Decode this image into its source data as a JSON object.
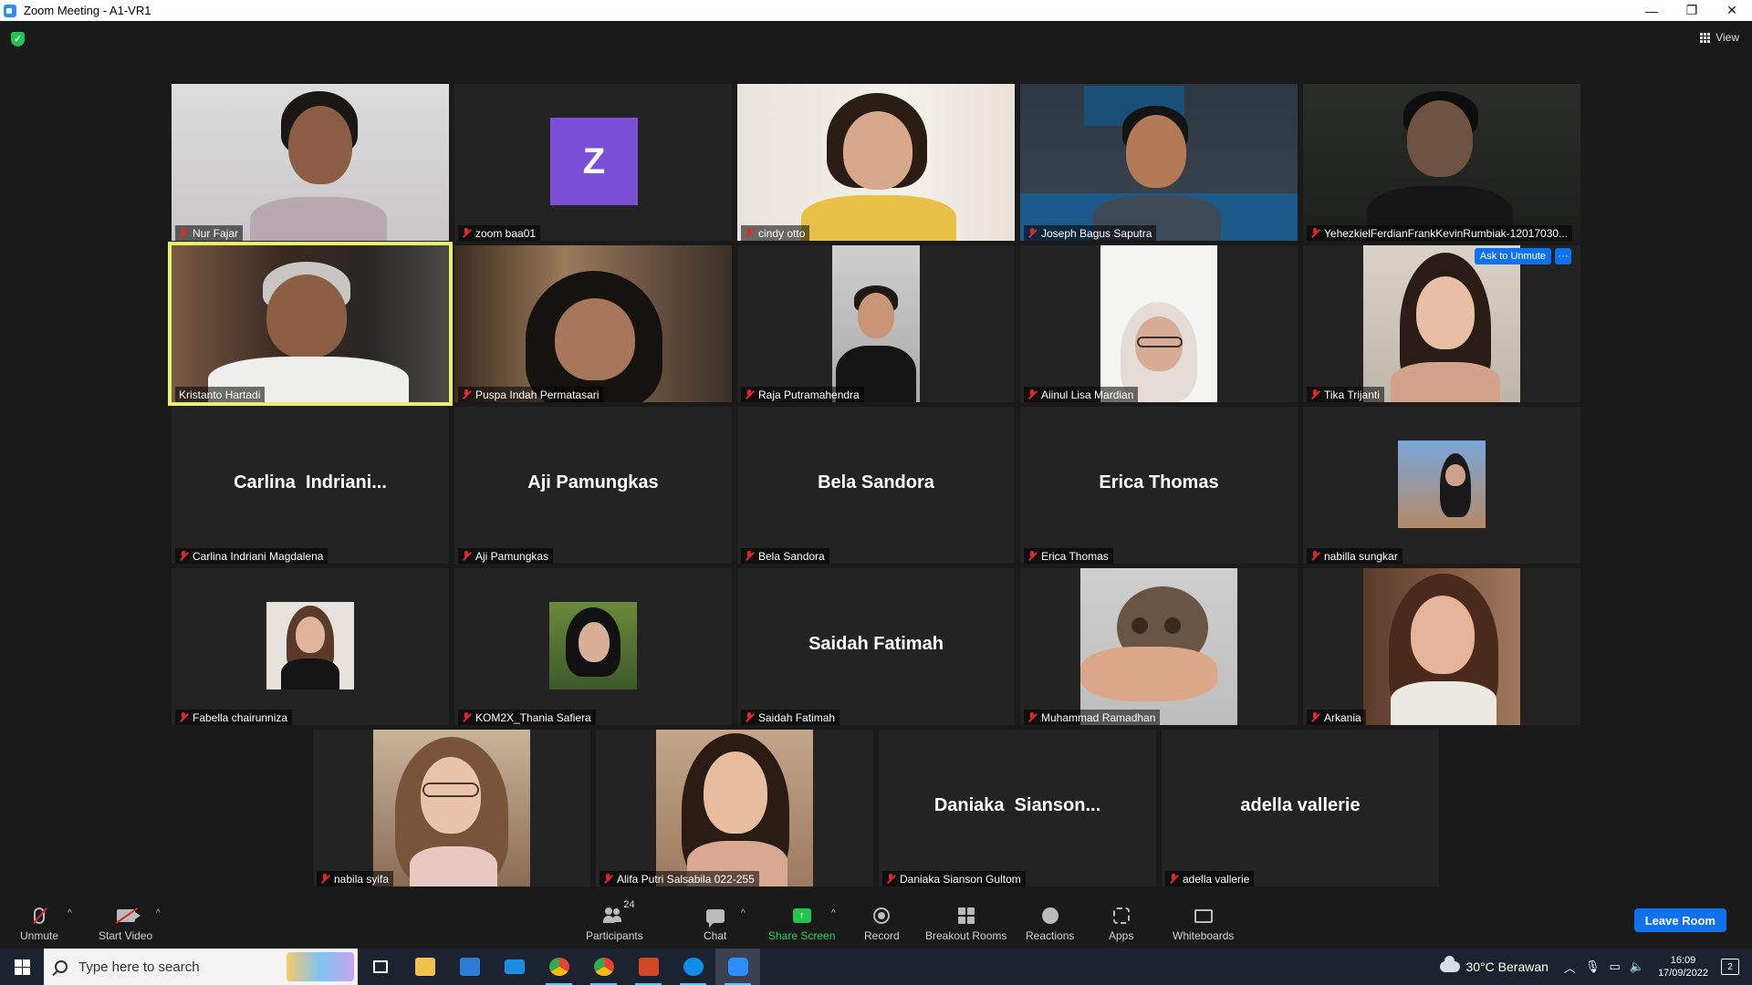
{
  "window": {
    "title": "Zoom Meeting - A1-VR1",
    "minimize": "—",
    "restore": "❐",
    "close": "✕"
  },
  "topbar": {
    "view_label": "View"
  },
  "participants": [
    {
      "name": "Nur Fajar"
    },
    {
      "name": "zoom baa01",
      "avatar_letter": "Z"
    },
    {
      "name": "cindy otto"
    },
    {
      "name": "Joseph Bagus Saputra"
    },
    {
      "name": "YehezkielFerdianFrankKevinRumbiak-12017030..."
    },
    {
      "name": "Kristanto Hartadi"
    },
    {
      "name": "Puspa Indah Permatasari"
    },
    {
      "name": "Raja Putramahendra"
    },
    {
      "name": "Aiinul Lisa Mardian"
    },
    {
      "name": "Tika Trijanti",
      "ask_unmute": "Ask to Unmute",
      "more": "···"
    },
    {
      "name": "Carlina Indriani Magdalena",
      "display_name": "Carlina  Indriani..."
    },
    {
      "name": "Aji Pamungkas",
      "display_name": "Aji Pamungkas"
    },
    {
      "name": "Bela Sandora",
      "display_name": "Bela Sandora"
    },
    {
      "name": "Erica Thomas",
      "display_name": "Erica Thomas"
    },
    {
      "name": "nabilla sungkar"
    },
    {
      "name": "Fabella chairunniza"
    },
    {
      "name": "KOM2X_Thania Safiera"
    },
    {
      "name": "Saidah Fatimah",
      "display_name": "Saidah Fatimah"
    },
    {
      "name": "Muhammad Ramadhan"
    },
    {
      "name": "Arkania"
    },
    {
      "name": "nabila syifa"
    },
    {
      "name": "Alifa Putri Salsabila 022-255"
    },
    {
      "name": "Daniaka Sianson Gultom",
      "display_name": "Daniaka  Sianson..."
    },
    {
      "name": "adella vallerie",
      "display_name": "adella vallerie"
    }
  ],
  "toolbar": {
    "unmute": "Unmute",
    "start_video": "Start Video",
    "participants": "Participants",
    "participants_count": "24",
    "chat": "Chat",
    "share_screen": "Share Screen",
    "record": "Record",
    "breakout_rooms": "Breakout Rooms",
    "reactions": "Reactions",
    "apps": "Apps",
    "whiteboards": "Whiteboards",
    "leave_room": "Leave Room",
    "caret": "^"
  },
  "taskbar": {
    "search_placeholder": "Type here to search",
    "weather": "30°C  Berawan",
    "time": "16:09",
    "date": "17/09/2022",
    "notification_count": "2"
  },
  "colors": {
    "accent": "#0e72ed",
    "active_speaker": "#e8ef6a",
    "share_green": "#23c552",
    "muted_red": "#e02828"
  }
}
